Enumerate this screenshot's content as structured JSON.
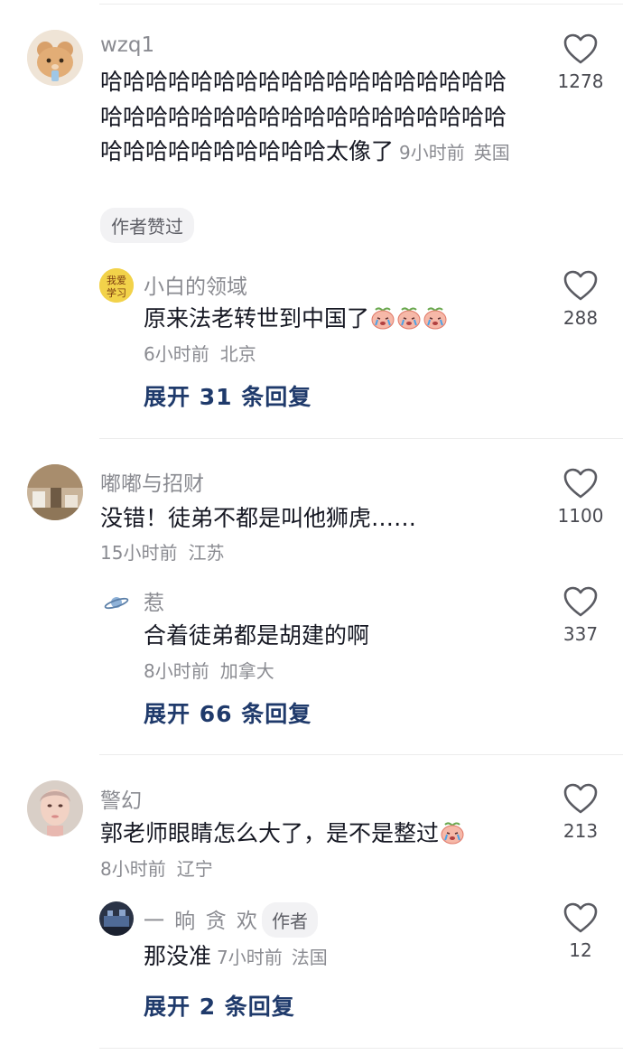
{
  "comments": [
    {
      "username": "wzq1",
      "text": "哈哈哈哈哈哈哈哈哈哈哈哈哈哈哈哈哈哈哈哈哈哈哈哈哈哈哈哈哈哈哈哈哈哈哈哈哈哈哈哈哈哈哈哈哈哈太像了",
      "time": "9小时前",
      "location": "英国",
      "badge": "作者赞过",
      "likes": "1278",
      "reply": {
        "username": "小白的领域",
        "text": "原来法老转世到中国了",
        "emoji_icons": [
          "crying-peach-emoji",
          "crying-peach-emoji",
          "crying-peach-emoji"
        ],
        "time": "6小时前",
        "location": "北京",
        "likes": "288",
        "avatar_text": [
          "我爱",
          "学习"
        ]
      },
      "expand_label": "展开 31 条回复"
    },
    {
      "username": "嘟嘟与招财",
      "text": "没错！徒弟不都是叫他狮虎……",
      "time": "15小时前",
      "location": "江苏",
      "likes": "1100",
      "reply": {
        "username": "惹",
        "text": "合着徒弟都是胡建的啊",
        "time": "8小时前",
        "location": "加拿大",
        "likes": "337"
      },
      "expand_label": "展开 66 条回复"
    },
    {
      "username": "警幻",
      "text": "郭老师眼睛怎么大了，是不是整过",
      "emoji_icons": [
        "crying-peach-emoji"
      ],
      "time": "8小时前",
      "location": "辽宁",
      "likes": "213",
      "reply": {
        "username": "一 晌 贪 欢",
        "author_tag": "作者",
        "text": "那没准",
        "time": "7小时前",
        "location": "法国",
        "likes": "12"
      },
      "expand_label": "展开 2 条回复"
    }
  ],
  "colors": {
    "text": "#161823",
    "meta": "#8a8b91",
    "expand": "#1f3a6b",
    "badge_bg": "#f2f2f4"
  }
}
